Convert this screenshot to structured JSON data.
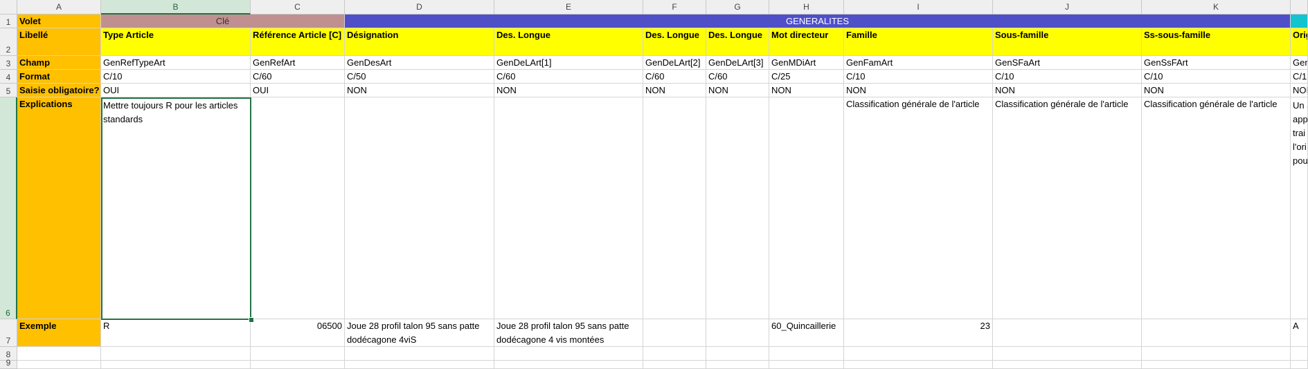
{
  "colors": {
    "orange": "#FFC000",
    "yellow": "#FFFF00",
    "mauve": "#C09090",
    "purple": "#4F4FC8",
    "cyan": "#12C4CF",
    "selection": "#217346"
  },
  "columns": [
    "A",
    "B",
    "C",
    "D",
    "E",
    "F",
    "G",
    "H",
    "I",
    "J",
    "K"
  ],
  "rows": [
    "1",
    "2",
    "3",
    "4",
    "5",
    "6",
    "7",
    "8",
    "9"
  ],
  "row1": {
    "label": "Volet",
    "key": "Clé",
    "general": "GENERALITES"
  },
  "row2": {
    "label": "Libellé",
    "cells": [
      "Type Article",
      "Référence Article [C]",
      "Désignation",
      "Des. Longue",
      "Des. Longue",
      "Des. Longue",
      "Mot directeur",
      "Famille",
      "Sous-famille",
      "Ss-sous-famille",
      "Orig"
    ]
  },
  "row3": {
    "label": "Champ",
    "cells": [
      "GenRefTypeArt",
      "GenRefArt",
      "GenDesArt",
      "GenDeLArt[1]",
      "GenDeLArt[2]",
      "GenDeLArt[3]",
      "GenMDiArt",
      "GenFamArt",
      "GenSFaArt",
      "GenSsFArt",
      "Gen"
    ]
  },
  "row4": {
    "label": "Format",
    "cells": [
      "C/10",
      "C/60",
      "C/50",
      "C/60",
      "C/60",
      "C/60",
      "C/25",
      "C/10",
      "C/10",
      "C/10",
      "C/1"
    ]
  },
  "row5": {
    "label": "Saisie obligatoire?",
    "cells": [
      "OUI",
      "OUI",
      "NON",
      "NON",
      "NON",
      "NON",
      "NON",
      "NON",
      "NON",
      "NON",
      "NOI"
    ]
  },
  "row6": {
    "label": "Explications",
    "b": "Mettre toujours R pour les articles standards",
    "i": "Classification générale de l'article",
    "j": "Classification générale de l'article",
    "k": "Classification générale de l'article",
    "l": [
      "Un a",
      "app",
      "trai",
      "l'ori",
      "pou"
    ]
  },
  "row7": {
    "label": "Exemple",
    "b": "R",
    "c": "06500",
    "d": "Joue 28 profil talon 95 sans patte dodécagone 4viS",
    "e": "Joue 28 profil talon 95 sans patte dodécagone 4 vis montées",
    "h": "60_Quincaillerie",
    "i": "23",
    "l": "A"
  }
}
